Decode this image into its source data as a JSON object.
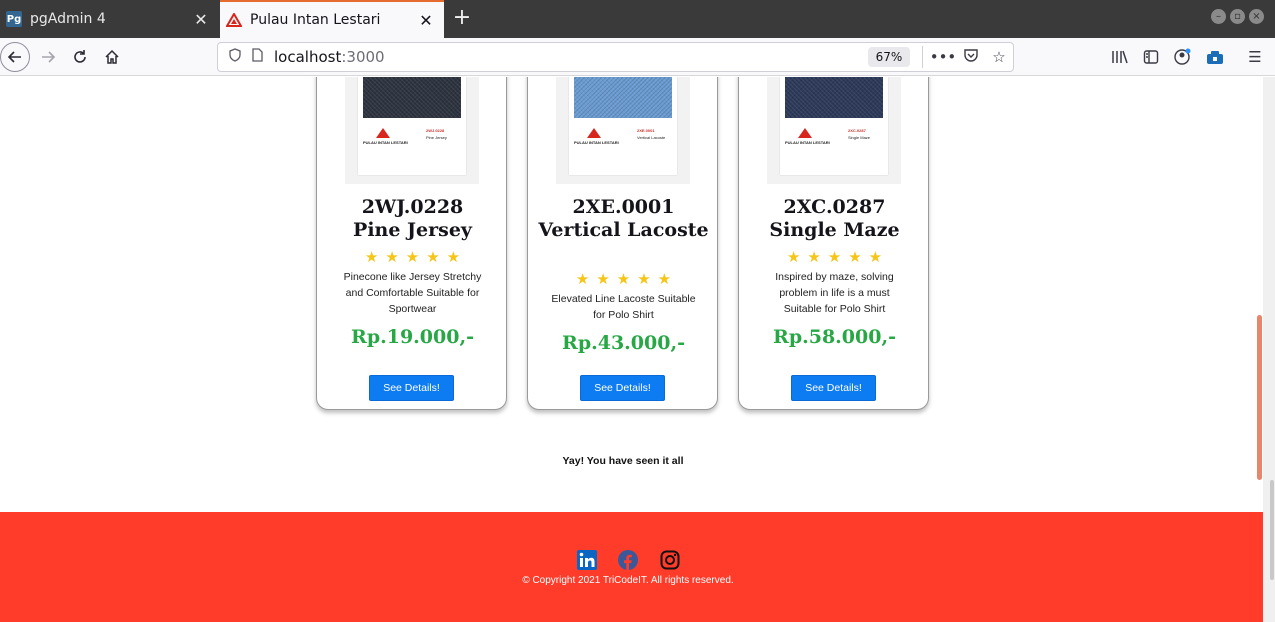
{
  "browser": {
    "tabs": [
      {
        "title": "pgAdmin 4",
        "favicon": "Pg",
        "active": false
      },
      {
        "title": "Pulau Intan Lestari",
        "favicon": "pil-logo-icon",
        "active": true
      }
    ],
    "url_host": "localhost",
    "url_port": ":3000",
    "zoom": "67%"
  },
  "products": [
    {
      "code": "2WJ.0228",
      "name": "Pine Jersey",
      "rating": 5,
      "description": "Pinecone like Jersey Stretchy and Comfortable Suitable for Sportwear",
      "price": "Rp.19.000,-",
      "button_label": "See Details!",
      "swatch_color": "#2e3440",
      "swatch_brand": "PULAU INTAN LESTARI",
      "swatch_code": "2WJ.0228",
      "swatch_name": "Pine Jersey"
    },
    {
      "code": "2XE.0001",
      "name": "Vertical Lacoste",
      "rating": 5,
      "description": "Elevated Line Lacoste Suitable for Polo Shirt",
      "price": "Rp.43.000,-",
      "button_label": "See Details!",
      "swatch_color": "#6a9bd1",
      "swatch_brand": "PULAU INTAN LESTARI",
      "swatch_code": "2XE.0001",
      "swatch_name": "Vertical Lacoste"
    },
    {
      "code": "2XC.0287",
      "name": "Single Maze",
      "rating": 5,
      "description": "Inspired by maze, solving problem in life is a must Suitable for Polo Shirt",
      "price": "Rp.58.000,-",
      "button_label": "See Details!",
      "swatch_color": "#2d3a5a",
      "swatch_brand": "PULAU INTAN LESTARI",
      "swatch_code": "2XC.0287",
      "swatch_name": "Single Maze"
    }
  ],
  "end_message": "Yay! You have seen it all",
  "footer": {
    "social": [
      "linkedin-icon",
      "facebook-icon",
      "instagram-icon"
    ],
    "copyright": "© Copyright 2021 TriCodeIT. All rights reserved.",
    "background": "#ff3b2a"
  },
  "colors": {
    "price": "#28a745",
    "button": "#0d7bf2",
    "star": "#f5c518",
    "tab_accent": "#e66b2f"
  }
}
